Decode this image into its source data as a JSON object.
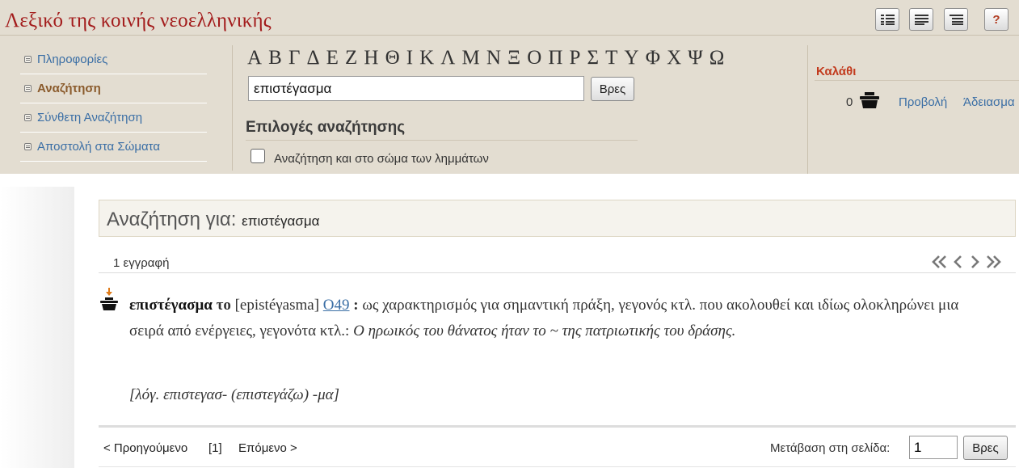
{
  "header": {
    "title": "Λεξικό της κοινής νεοελληνικής",
    "tools": [
      "list-view-icon",
      "detailed-view-icon",
      "tree-view-icon"
    ],
    "help_label": "?"
  },
  "nav": {
    "items": [
      {
        "label": "Πληροφορίες",
        "active": false
      },
      {
        "label": "Αναζήτηση",
        "active": true
      },
      {
        "label": "Σύνθετη Αναζήτηση",
        "active": false
      },
      {
        "label": "Αποστολή στα Σώματα",
        "active": false
      }
    ]
  },
  "alphabet": [
    "Α",
    "Β",
    "Γ",
    "Δ",
    "Ε",
    "Ζ",
    "Η",
    "Θ",
    "Ι",
    "Κ",
    "Λ",
    "Μ",
    "Ν",
    "Ξ",
    "Ο",
    "Π",
    "Ρ",
    "Σ",
    "Τ",
    "Υ",
    "Φ",
    "Χ",
    "Ψ",
    "Ω"
  ],
  "search": {
    "value": "επιστέγασμα",
    "button_label": "Βρες",
    "options_title": "Επιλογές αναζήτησης",
    "checkbox_label": "Αναζήτηση και στο σώμα των λημμάτων"
  },
  "basket": {
    "title": "Καλάθι",
    "count": "0",
    "view_label": "Προβολή",
    "empty_label": "Άδειασμα"
  },
  "results": {
    "header_label": "Αναζήτηση για:",
    "header_term": "επιστέγασμα",
    "count_text": "1 εγγραφή",
    "entry": {
      "lemma": "επιστέγασμα",
      "gram": "το",
      "pron": "[epistéγasma]",
      "code": "O49",
      "colon": ":",
      "definition": "ως χαρακτηρισμός για σημαντική πράξη, γεγονός κτλ. που ακολουθεί και ιδίως ολοκληρώνει μια σειρά από ενέργειες, γεγονότα κτλ.:",
      "example": "Ο ηρωικός του θάνατος ήταν το ~ της πατριωτικής του δράσης.",
      "etymology": "[λόγ. επιστεγασ- (επιστεγάζω) -μα]"
    }
  },
  "pagination": {
    "prev_label": "< Προηγούμενο",
    "current": "[1]",
    "next_label": "Επόμενο >",
    "goto_label": "Μετάβαση στη σελίδα:",
    "goto_value": "1",
    "goto_button": "Βρες"
  },
  "colors": {
    "header_bg": "#e3ddd1",
    "title_red": "#a31c1c",
    "link_blue": "#3a6ea5",
    "active_brown": "#8a5a2b",
    "basket_red": "#c23a1d"
  }
}
